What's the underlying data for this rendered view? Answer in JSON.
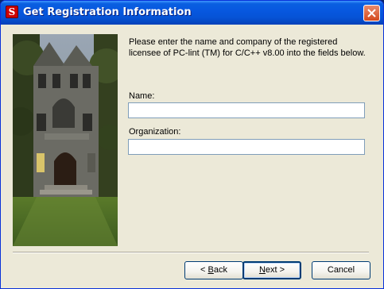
{
  "window": {
    "title": "Get Registration Information",
    "app_icon_glyph": "S"
  },
  "instructions": "Please enter the name and company of the registered licensee of PC-lint (TM) for C/C++ v8.00 into the fields below.",
  "form": {
    "name_label": "Name:",
    "name_value": "",
    "organization_label": "Organization:",
    "organization_value": ""
  },
  "buttons": {
    "back_arrow": "< ",
    "back_key": "B",
    "back_rest": "ack",
    "next_key": "N",
    "next_rest": "ext",
    "next_arrow": " >",
    "cancel_label": "Cancel"
  },
  "colors": {
    "titlebar": "#0758e0",
    "dialog_bg": "#ece9d8",
    "close_button": "#d44a1e"
  },
  "icons": {
    "app": "pc-lint-app-icon",
    "close": "close-x-icon",
    "picture": "building-photo"
  }
}
